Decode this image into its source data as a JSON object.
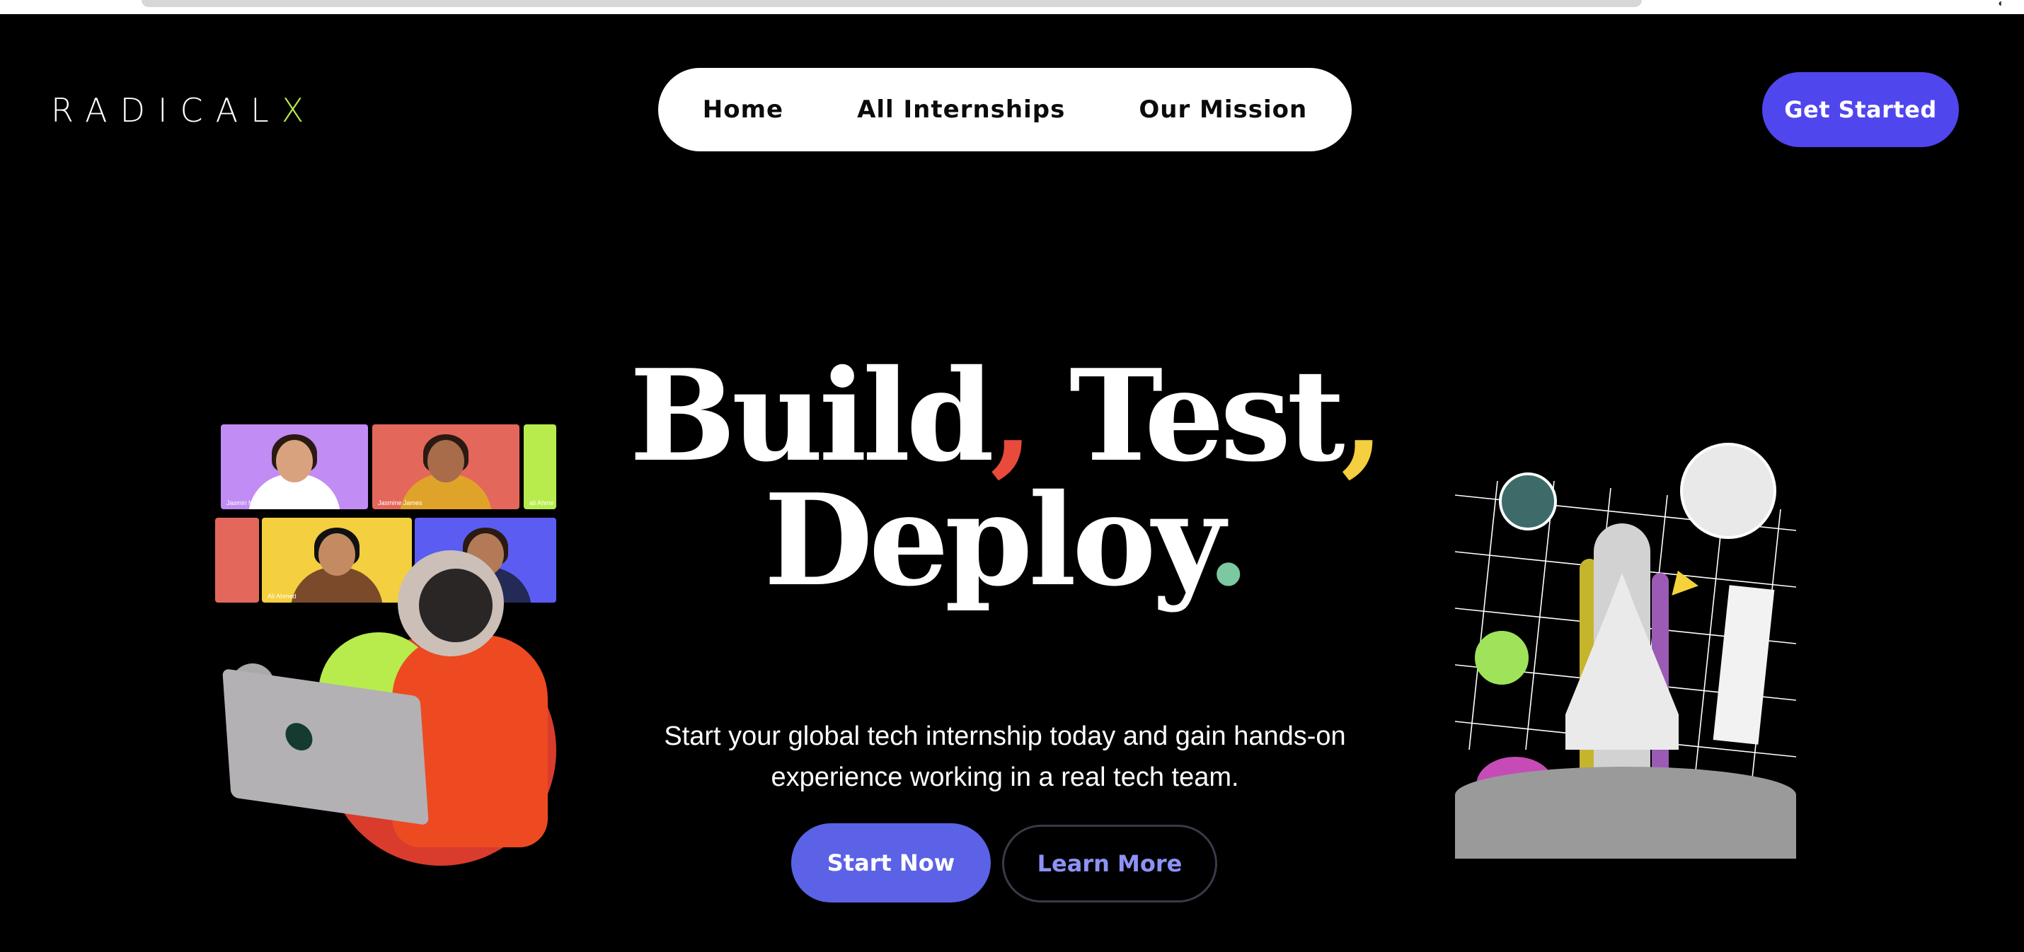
{
  "brand": {
    "logo_main": "RADICAL",
    "logo_accent": "X",
    "accent_color": "#b8ea4a",
    "primary_color": "#5046ee"
  },
  "nav": {
    "items": [
      {
        "label": "Home"
      },
      {
        "label": "All Internships"
      },
      {
        "label": "Our Mission"
      }
    ],
    "cta_label": "Get Started"
  },
  "hero": {
    "title_line1_word1": "Build",
    "title_line1_comma1": ",",
    "title_line1_word2": "Test",
    "title_line1_comma2": ",",
    "title_line2_word": "Deploy",
    "title_line2_period": ".",
    "subtitle_line1": "Start your global tech internship today and gain hands-on",
    "subtitle_line2": "experience working in a real tech team.",
    "primary_button": "Start Now",
    "secondary_button": "Learn More",
    "punctuation_colors": {
      "comma1": "#e84b3c",
      "comma2": "#f4cf3f",
      "period": "#7cc8a0"
    }
  },
  "left_illustration": {
    "tiles": [
      {
        "name": "Jasmin Mor",
        "color": "#c18cf3"
      },
      {
        "name": "Jasmine James",
        "color": "#e4675c"
      },
      {
        "name": "ali Ahme",
        "color": "#b7ec4c"
      },
      {
        "name": "",
        "color": "#e4675c"
      },
      {
        "name": "Ali Ahmed",
        "color": "#f4cf3f"
      },
      {
        "name": "",
        "color": "#5b5cf2"
      }
    ]
  }
}
